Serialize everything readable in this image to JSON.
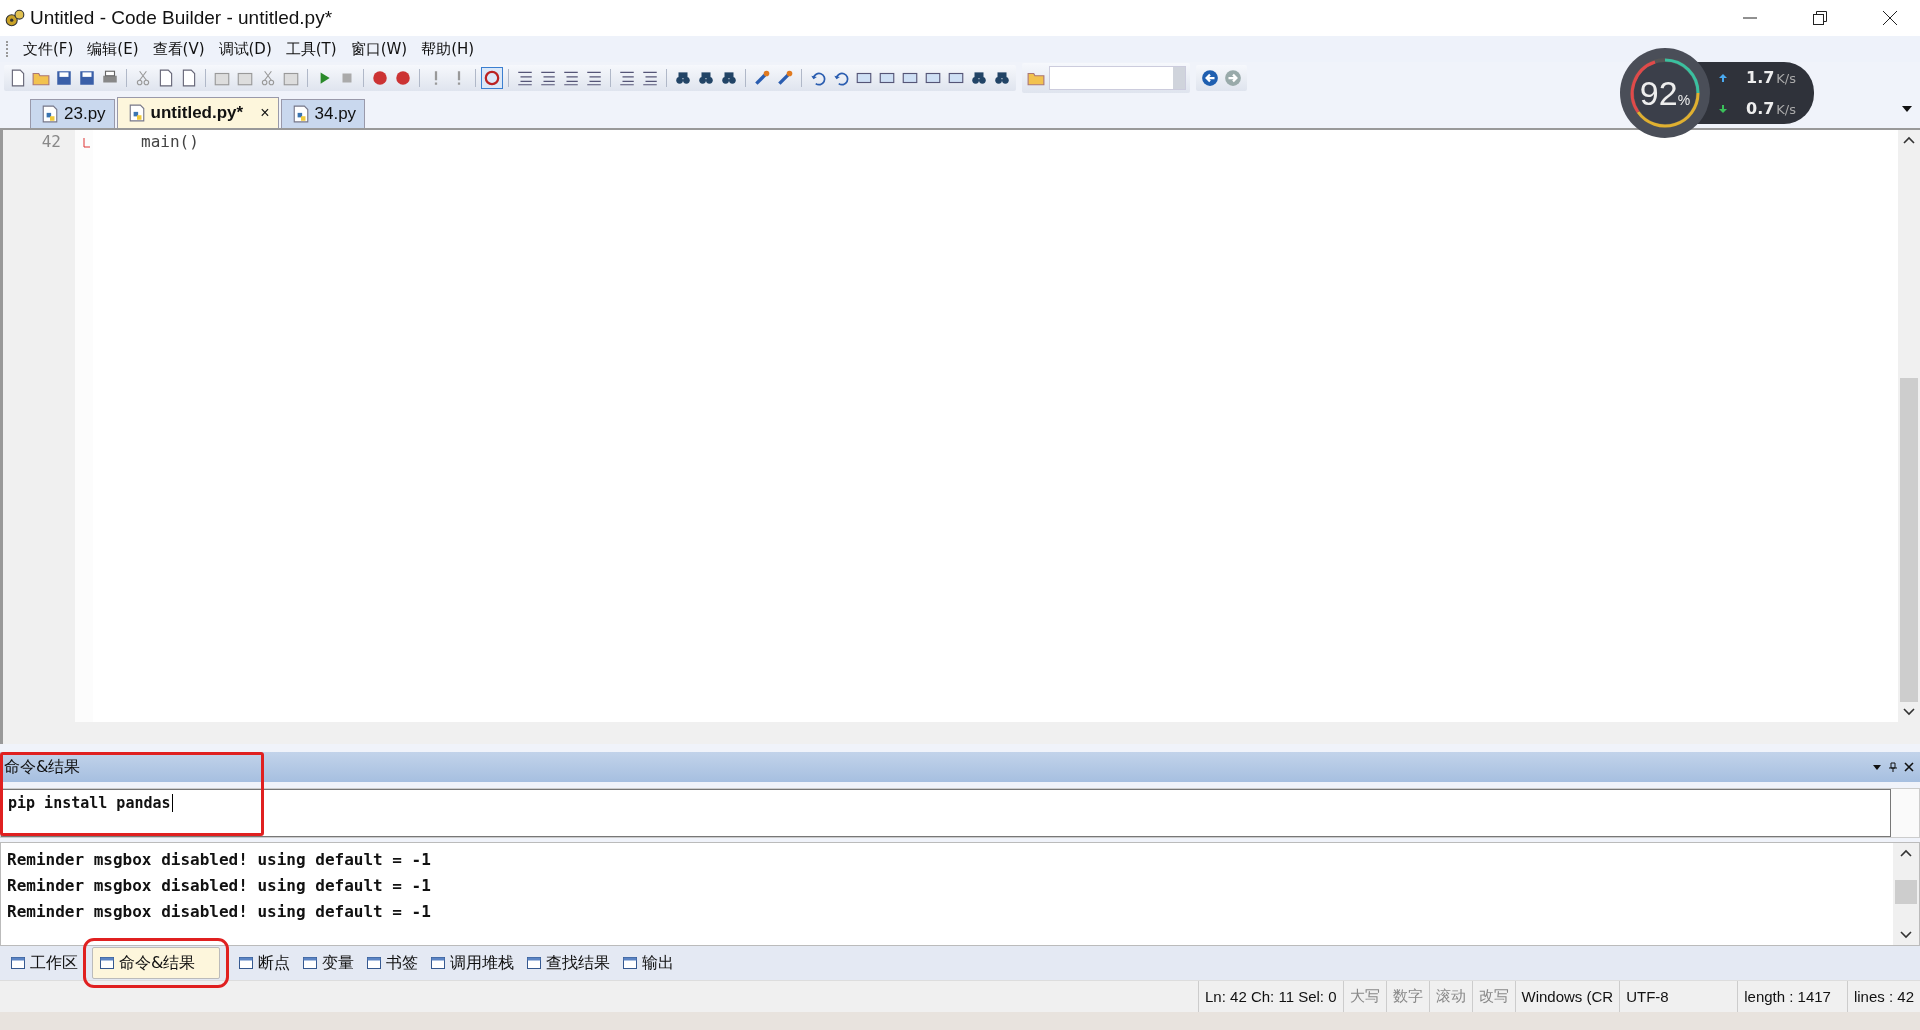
{
  "window": {
    "title": "Untitled - Code Builder - untitled.py*"
  },
  "menu": [
    "文件(F)",
    "编辑(E)",
    "查看(V)",
    "调试(D)",
    "工具(T)",
    "窗口(W)",
    "帮助(H)"
  ],
  "network_monitor": {
    "percent": "92",
    "percent_unit": "%",
    "upload": "1.7",
    "upload_unit": "K/s",
    "download": "0.7",
    "download_unit": "K/s"
  },
  "tabs": [
    {
      "label": "23.py",
      "selected": false
    },
    {
      "label": "untitled.py*",
      "selected": true,
      "close": "×"
    },
    {
      "label": "34.py",
      "selected": false
    }
  ],
  "editor": {
    "lines": [
      {
        "number": "42",
        "code": "main()"
      }
    ]
  },
  "command_panel": {
    "title": "命令&结果",
    "input_value": "pip install pandas",
    "output_lines": [
      "Reminder msgbox disabled! using default = -1",
      "Reminder msgbox disabled! using default = -1",
      "Reminder msgbox disabled! using default = -1"
    ]
  },
  "bottom_tabs": [
    {
      "label": "工作区",
      "selected": false
    },
    {
      "label": "命令&结果",
      "selected": true
    },
    {
      "label": "断点",
      "selected": false
    },
    {
      "label": "变量",
      "selected": false
    },
    {
      "label": "书签",
      "selected": false
    },
    {
      "label": "调用堆栈",
      "selected": false
    },
    {
      "label": "查找结果",
      "selected": false
    },
    {
      "label": "输出",
      "selected": false
    }
  ],
  "status_bar": {
    "position": "Ln: 42 Ch: 11 Sel: 0",
    "indicators": [
      {
        "label": "大写",
        "on": false
      },
      {
        "label": "数字",
        "on": false
      },
      {
        "label": "滚动",
        "on": false
      },
      {
        "label": "改写",
        "on": false
      }
    ],
    "line_ending": "Windows (CR",
    "encoding": "UTF-8",
    "length": "length : 1417",
    "lines": "lines : 42"
  }
}
